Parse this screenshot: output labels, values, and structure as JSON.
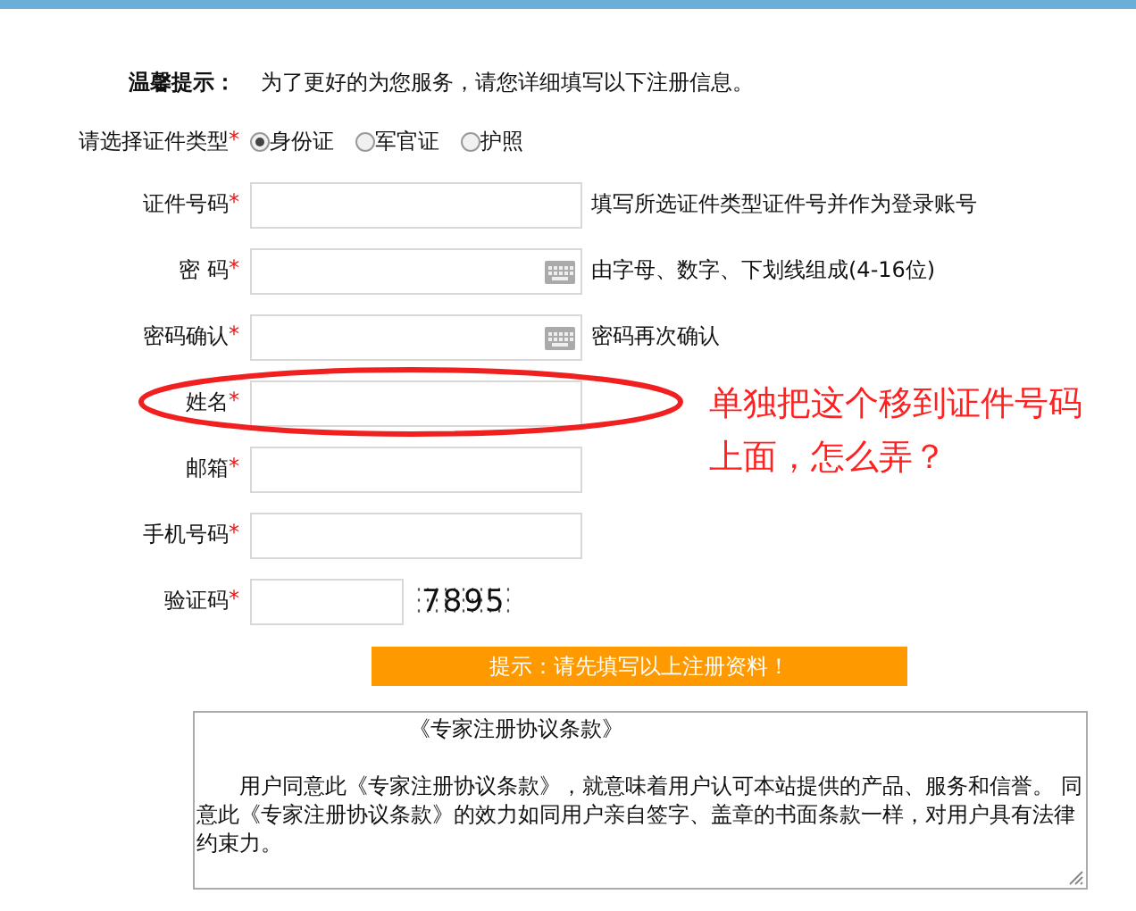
{
  "notice": {
    "label": "温馨提示：",
    "text": "为了更好的为您服务，请您详细填写以下注册信息。"
  },
  "id_type": {
    "label": "请选择证件类型",
    "mark": "*",
    "options": [
      {
        "label": "身份证",
        "selected": true
      },
      {
        "label": "军官证",
        "selected": false
      },
      {
        "label": "护照",
        "selected": false
      }
    ]
  },
  "fields": [
    {
      "kind": "text",
      "label": "证件号码",
      "mark": "*",
      "hint": "填写所选证件类型证件号并作为登录账号"
    },
    {
      "kind": "password",
      "label": "密 码",
      "mark": "*",
      "hint": "由字母、数字、下划线组成(4-16位)"
    },
    {
      "kind": "password",
      "label": "密码确认",
      "mark": "*",
      "hint": "密码再次确认"
    },
    {
      "kind": "text",
      "label": "姓名",
      "mark": "*"
    },
    {
      "kind": "text",
      "label": "邮箱",
      "mark": "*"
    },
    {
      "kind": "text",
      "label": "手机号码",
      "mark": "*"
    },
    {
      "kind": "captcha",
      "label": "验证码",
      "mark": "*",
      "captcha": "7895"
    }
  ],
  "submit_hint": "提示：请先填写以上注册资料！",
  "agreement": {
    "title": "《专家注册协议条款》",
    "body": "用户同意此《专家注册协议条款》，就意味着用户认可本站提供的产品、服务和信誉。 同意此《专家注册协议条款》的效力如同用户亲自签字、盖章的书面条款一样，对用户具有法律约束力。"
  },
  "annotation": {
    "lines": [
      "单独把这个移到证件号码",
      "上面，怎么弄？"
    ]
  }
}
